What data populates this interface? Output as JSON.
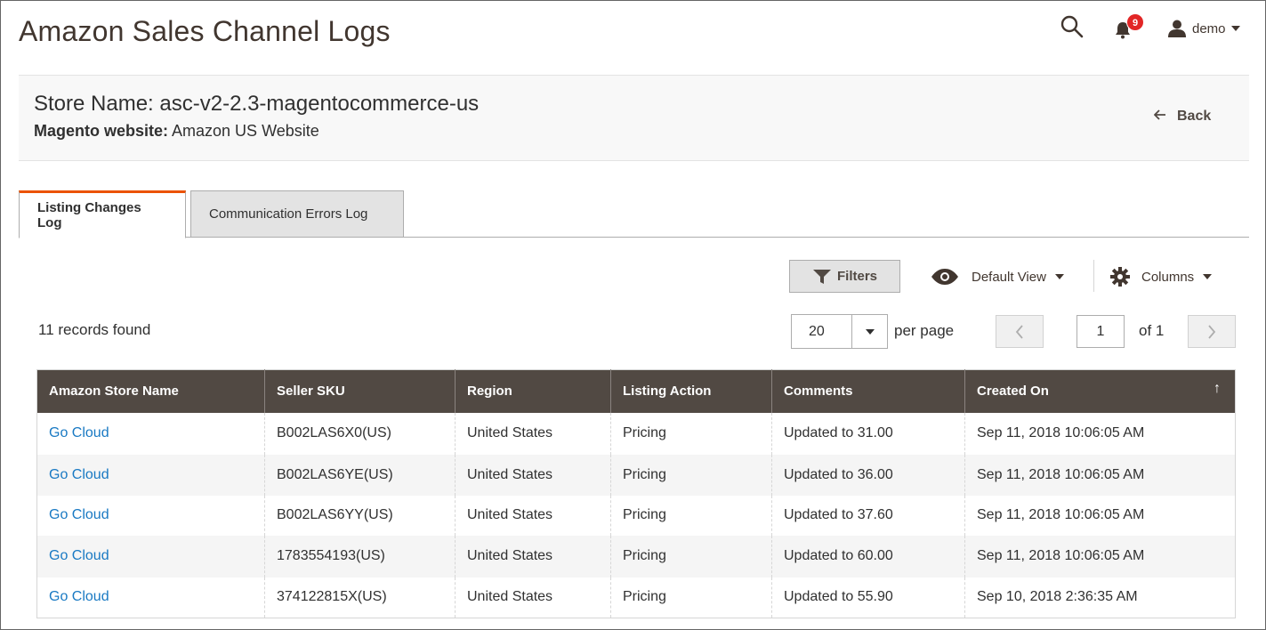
{
  "page": {
    "title": "Amazon Sales Channel Logs"
  },
  "header": {
    "notification_count": "9",
    "user_name": "demo"
  },
  "store": {
    "name": "Store Name: asc-v2-2.3-magentocommerce-us",
    "website_label": "Magento website:",
    "website_value": " Amazon US Website",
    "back_label": "Back"
  },
  "tabs": [
    {
      "label": "Listing Changes Log",
      "active": true
    },
    {
      "label": "Communication Errors Log",
      "active": false
    }
  ],
  "toolbar": {
    "filters_label": "Filters",
    "view_label": "Default View",
    "columns_label": "Columns",
    "records_found": "11 records found",
    "per_page_value": "20",
    "per_page_label": "per page",
    "current_page": "1",
    "page_of": "of 1"
  },
  "table": {
    "headers": [
      "Amazon Store Name",
      "Seller SKU",
      "Region",
      "Listing Action",
      "Comments",
      "Created On"
    ],
    "rows": [
      [
        "Go Cloud",
        "B002LAS6X0(US)",
        "United States",
        "Pricing",
        "Updated to 31.00",
        "Sep 11, 2018 10:06:05 AM"
      ],
      [
        "Go Cloud",
        "B002LAS6YE(US)",
        "United States",
        "Pricing",
        "Updated to 36.00",
        "Sep 11, 2018 10:06:05 AM"
      ],
      [
        "Go Cloud",
        "B002LAS6YY(US)",
        "United States",
        "Pricing",
        "Updated to 37.60",
        "Sep 11, 2018 10:06:05 AM"
      ],
      [
        "Go Cloud",
        "1783554193(US)",
        "United States",
        "Pricing",
        "Updated to 60.00",
        "Sep 11, 2018 10:06:05 AM"
      ],
      [
        "Go Cloud",
        "374122815X(US)",
        "United States",
        "Pricing",
        "Updated to 55.90",
        "Sep 10, 2018 2:36:35 AM"
      ]
    ],
    "sort_arrow": "↑"
  },
  "colors": {
    "tab_accent": "#eb5202",
    "table_header_bg": "#514943",
    "link": "#1979c3",
    "badge": "#e22626"
  },
  "icons": {
    "search": "search-icon",
    "notifications": "bell-icon",
    "user": "user-icon",
    "back": "arrow-left-icon",
    "filters": "funnel-icon",
    "view": "eye-icon",
    "columns": "gear-icon"
  }
}
